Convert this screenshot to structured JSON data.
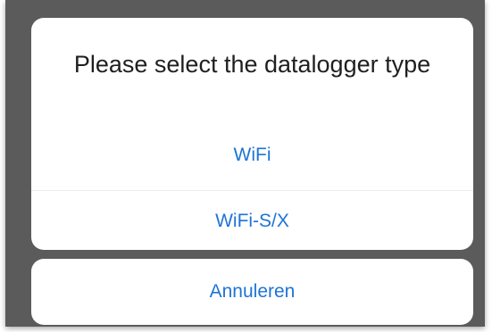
{
  "dialog": {
    "title": "Please select the datalogger type",
    "options": [
      {
        "label": "WiFi"
      },
      {
        "label": "WiFi-S/X"
      }
    ],
    "cancel_label": "Annuleren"
  },
  "colors": {
    "overlay": "#5b5b5b",
    "sheet": "#ffffff",
    "accent": "#1f74d4",
    "title_text": "#1f1f1f"
  }
}
